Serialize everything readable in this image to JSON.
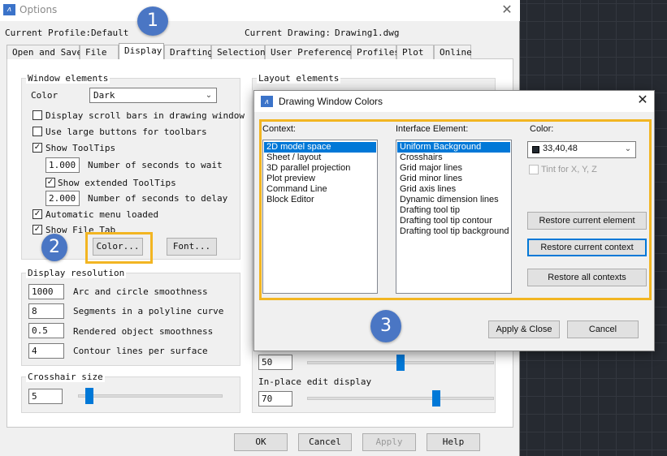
{
  "options": {
    "title": "Options",
    "close_glyph": "✕",
    "current_profile": "Current Profile:Default",
    "current_drawing_label": "Current Drawing:",
    "current_drawing_value": "Drawing1.dwg",
    "tabs": [
      "Open and Save",
      "File",
      "Display",
      "Drafting",
      "Selection",
      "User Preferences",
      "Profiles",
      "Plot",
      "Online"
    ],
    "active_tab": "Display",
    "window_elements": {
      "title": "Window elements",
      "color_label": "Color",
      "color_value": "Dark",
      "scroll_bars": "Display scroll bars in drawing window",
      "large_buttons": "Use large buttons for toolbars",
      "show_tooltips": "Show ToolTips",
      "tooltip_wait_value": "1.000",
      "tooltip_wait_label": "Number of seconds to wait",
      "show_extended": "Show extended ToolTips",
      "extended_delay_value": "2.000",
      "extended_delay_label": "Number of seconds to delay",
      "auto_menu": "Automatic menu loaded",
      "show_file_tab": "Show File Tab",
      "color_button": "Color...",
      "font_button": "Font...",
      "checked": {
        "scroll_bars": false,
        "large_buttons": false,
        "show_tooltips": true,
        "show_extended": true,
        "auto_menu": true,
        "show_file_tab": true
      }
    },
    "display_resolution": {
      "title": "Display resolution",
      "rows": [
        {
          "value": "1000",
          "label": "Arc and circle smoothness"
        },
        {
          "value": "8",
          "label": "Segments in a polyline curve"
        },
        {
          "value": "0.5",
          "label": "Rendered object smoothness"
        },
        {
          "value": "4",
          "label": "Contour lines per surface"
        }
      ]
    },
    "crosshair": {
      "title": "Crosshair size",
      "value": "5",
      "level_fraction": 0.05
    },
    "layout_elements": {
      "title": "Layout elements"
    },
    "fade_value": "50",
    "fade_fraction": 0.5,
    "inplace": {
      "title": "In-place edit display",
      "value": "70",
      "level_fraction": 0.7
    },
    "buttons": {
      "ok": "OK",
      "cancel": "Cancel",
      "apply": "Apply",
      "help": "Help"
    }
  },
  "dialog": {
    "title": "Drawing Window Colors",
    "close_glyph": "✕",
    "context_label": "Context:",
    "contexts": [
      "2D model space",
      "Sheet / layout",
      "3D parallel projection",
      "Plot preview",
      "Command Line",
      "Block Editor"
    ],
    "selected_context": "2D model space",
    "interface_label": "Interface Element:",
    "interface_elements": [
      "Uniform Background",
      "Crosshairs",
      "Grid major lines",
      "Grid minor lines",
      "Grid axis lines",
      "Dynamic dimension lines",
      "Drafting tool tip",
      "Drafting tool tip contour",
      "Drafting tool tip background"
    ],
    "selected_element": "Uniform Background",
    "color_label": "Color:",
    "color_value": "33,40,48",
    "swatch_color": "#21282f",
    "tint_label": "Tint for X, Y, Z",
    "restore_element": "Restore current element",
    "restore_context": "Restore current context",
    "restore_all": "Restore all contexts",
    "apply_close": "Apply & Close",
    "cancel": "Cancel"
  },
  "badges": [
    "1",
    "2",
    "3"
  ],
  "colors": {
    "accent": "#0078d7",
    "callout": "#f2b522",
    "badge": "#4a76c4"
  }
}
